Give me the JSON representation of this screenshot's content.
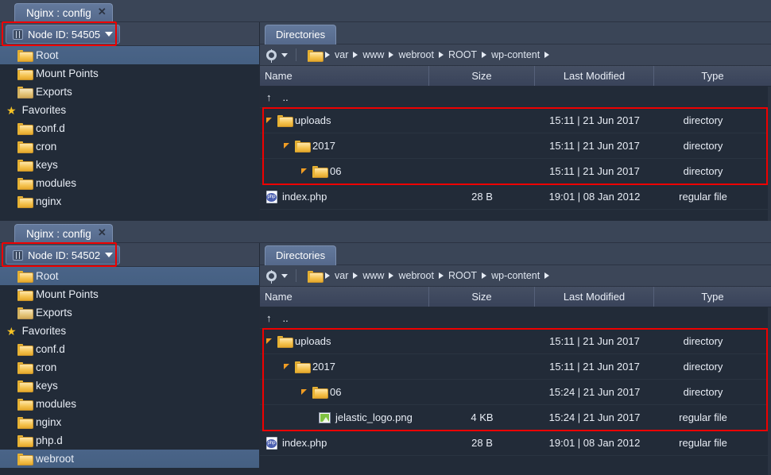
{
  "panels": [
    {
      "tab": {
        "label": "Nginx : config",
        "close": "✕"
      },
      "node": {
        "label": "Node ID: 54505",
        "icon": "grid-icon"
      },
      "sidebar": {
        "top_items": [
          {
            "label": "Root",
            "icon": "folder-icon",
            "selected": true
          },
          {
            "label": "Mount Points",
            "icon": "folder-mount-icon",
            "selected": false
          },
          {
            "label": "Exports",
            "icon": "folder-exports-icon",
            "selected": false
          }
        ],
        "favorites_label": "Favorites",
        "favorites": [
          {
            "label": "conf.d"
          },
          {
            "label": "cron"
          },
          {
            "label": "keys"
          },
          {
            "label": "modules"
          },
          {
            "label": "nginx"
          }
        ]
      },
      "content_tab": "Directories",
      "breadcrumbs": [
        "var",
        "www",
        "webroot",
        "ROOT",
        "wp-content"
      ],
      "columns": [
        "Name",
        "Size",
        "Last Modified",
        "Type"
      ],
      "parent_row": "..",
      "rows": [
        {
          "name": "uploads",
          "indent": 0,
          "icon": "folder-icon",
          "expander": true,
          "size": "",
          "modified": "15:11 | 21 Jun 2017",
          "type": "directory",
          "highlight": true
        },
        {
          "name": "2017",
          "indent": 1,
          "icon": "folder-icon",
          "expander": true,
          "size": "",
          "modified": "15:11 | 21 Jun 2017",
          "type": "directory",
          "highlight": true
        },
        {
          "name": "06",
          "indent": 2,
          "icon": "folder-icon",
          "expander": true,
          "size": "",
          "modified": "15:11 | 21 Jun 2017",
          "type": "directory",
          "highlight": true
        },
        {
          "name": "index.php",
          "indent": 0,
          "icon": "php-file-icon",
          "expander": false,
          "size": "28 B",
          "modified": "19:01 | 08 Jan 2012",
          "type": "regular file",
          "highlight": false
        }
      ]
    },
    {
      "tab": {
        "label": "Nginx : config",
        "close": "✕"
      },
      "node": {
        "label": "Node ID: 54502",
        "icon": "grid-icon"
      },
      "sidebar": {
        "top_items": [
          {
            "label": "Root",
            "icon": "folder-icon",
            "selected": true
          },
          {
            "label": "Mount Points",
            "icon": "folder-mount-icon",
            "selected": false
          },
          {
            "label": "Exports",
            "icon": "folder-exports-icon",
            "selected": false
          }
        ],
        "favorites_label": "Favorites",
        "favorites": [
          {
            "label": "conf.d"
          },
          {
            "label": "cron"
          },
          {
            "label": "keys"
          },
          {
            "label": "modules"
          },
          {
            "label": "nginx"
          },
          {
            "label": "php.d"
          },
          {
            "label": "webroot",
            "selected": true
          }
        ]
      },
      "content_tab": "Directories",
      "breadcrumbs": [
        "var",
        "www",
        "webroot",
        "ROOT",
        "wp-content"
      ],
      "columns": [
        "Name",
        "Size",
        "Last Modified",
        "Type"
      ],
      "parent_row": "..",
      "rows": [
        {
          "name": "uploads",
          "indent": 0,
          "icon": "folder-icon",
          "expander": true,
          "size": "",
          "modified": "15:11 | 21 Jun 2017",
          "type": "directory",
          "highlight": true
        },
        {
          "name": "2017",
          "indent": 1,
          "icon": "folder-icon",
          "expander": true,
          "size": "",
          "modified": "15:11 | 21 Jun 2017",
          "type": "directory",
          "highlight": true
        },
        {
          "name": "06",
          "indent": 2,
          "icon": "folder-icon",
          "expander": true,
          "size": "",
          "modified": "15:24 | 21 Jun 2017",
          "type": "directory",
          "highlight": true
        },
        {
          "name": "jelastic_logo.png",
          "indent": 3,
          "icon": "image-file-icon",
          "expander": false,
          "size": "4 KB",
          "modified": "15:24 | 21 Jun 2017",
          "type": "regular file",
          "highlight": true
        },
        {
          "name": "index.php",
          "indent": 0,
          "icon": "php-file-icon",
          "expander": false,
          "size": "28 B",
          "modified": "19:01 | 08 Jan 2012",
          "type": "regular file",
          "highlight": false
        }
      ]
    }
  ],
  "colors": {
    "annotation": "#ee0000",
    "selection": "#4a6488",
    "folder": "#f4c24e",
    "background": "#222b38",
    "chrome": "#323c4e"
  }
}
